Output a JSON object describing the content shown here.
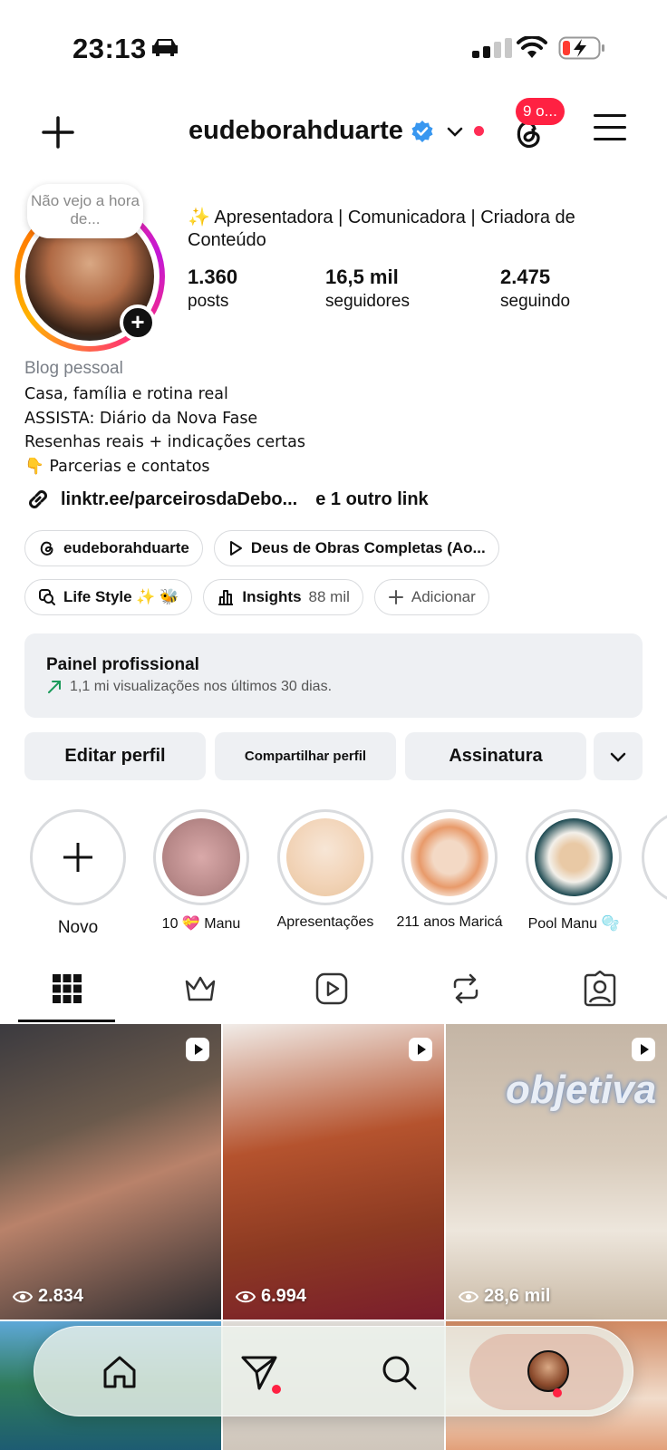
{
  "status_bar": {
    "time": "23:13"
  },
  "header": {
    "username": "eudeborahduarte",
    "threads_badge": "9 o..."
  },
  "profile": {
    "note": "Não vejo a hora de...",
    "bio_title": "✨ Apresentadora | Comunicadora | Criadora de Conteúdo",
    "stats": [
      {
        "value": "1.360",
        "label": "posts"
      },
      {
        "value": "16,5 mil",
        "label": "seguidores"
      },
      {
        "value": "2.475",
        "label": "seguindo"
      }
    ],
    "category": "Blog pessoal",
    "bio_lines": [
      "Casa, família e rotina real",
      "ASSISTA: Diário da Nova Fase",
      "Resenhas reais + indicações certas",
      "👇 Parcerias e contatos"
    ],
    "link": "linktr.ee/parceirosdaDebo...",
    "link_more": "e 1 outro link"
  },
  "chips_row1": [
    {
      "label": "eudeborahduarte",
      "icon": "threads-icon"
    },
    {
      "label": "Deus de Obras Completas (Ao...",
      "icon": "play-icon"
    }
  ],
  "chips_row2": [
    {
      "label": "Life Style ✨ 🐝",
      "icon": "search-icon"
    },
    {
      "label": "Insights",
      "extra": "88 mil",
      "icon": "bar-chart-icon"
    },
    {
      "label": "Adicionar",
      "icon": "plus-icon"
    }
  ],
  "pro_panel": {
    "title": "Painel profissional",
    "subtitle": "1,1 mi visualizações nos últimos 30 dias."
  },
  "actions": {
    "edit": "Editar perfil",
    "share": "Compartilhar perfil",
    "subscription": "Assinatura"
  },
  "highlights": [
    {
      "label": "Novo"
    },
    {
      "label": "10 💝 Manu"
    },
    {
      "label": "Apresentações"
    },
    {
      "label": "211 anos Maricá"
    },
    {
      "label": "Pool Manu 🫧"
    }
  ],
  "posts": [
    {
      "views": "2.834"
    },
    {
      "views": "6.994"
    },
    {
      "views": "28,6 mil",
      "sign": "objetiva"
    }
  ],
  "colors": {
    "accent_red": "#ff2142",
    "verified_blue": "#3897f0",
    "panel_gray": "#eef0f3"
  }
}
